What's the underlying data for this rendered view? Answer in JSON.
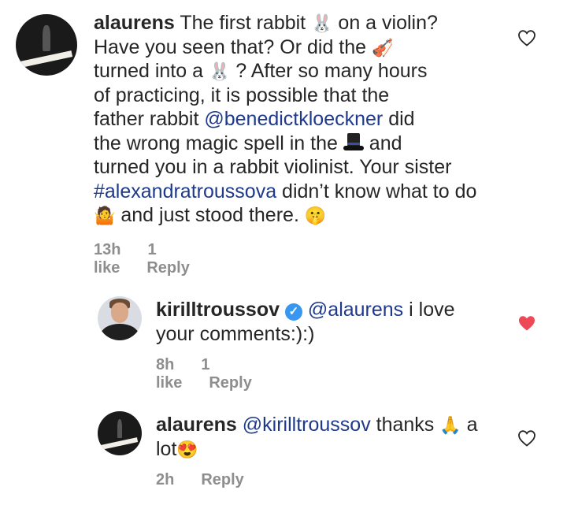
{
  "comments": [
    {
      "username": "alaurens",
      "lines": [
        [
          "The first rabbit ",
          "rabbit-emoji",
          " on a violin?"
        ],
        [
          "Have you seen that? Or did the ",
          "violin-emoji"
        ],
        [
          "turned into a ",
          "rabbit-emoji",
          " ? After so many hours"
        ],
        [
          "of practicing, it is possible that the"
        ],
        [
          "father rabbit ",
          "@benedictkloeckner",
          " did"
        ],
        [
          "the wrong magic spell in the ",
          "tophat-emoji",
          " and"
        ],
        [
          "turned you in a rabbit violinist. Your sister"
        ],
        [
          "#alexandratroussova",
          " didn’t know what to do"
        ],
        [
          "shrug-emoji",
          " and just stood there. ",
          "shush-emoji"
        ]
      ],
      "time": "13h",
      "likes": "1 like",
      "reply": "Reply",
      "liked": false
    },
    {
      "username": "kirilltroussov",
      "verified": true,
      "line1_mention": "@alaurens",
      "line1_text": " i love",
      "line2_text": "your comments:):)",
      "time": "8h",
      "likes": "1 like",
      "reply": "Reply",
      "liked": true
    },
    {
      "username": "alaurens",
      "line1_mention": "@kirilltroussov",
      "line1_text": " thanks ",
      "line1_tail": " a",
      "line2_text": "lot",
      "time": "2h",
      "reply": "Reply",
      "liked": false
    }
  ],
  "icons": {
    "rabbit-emoji": "🐰",
    "violin-emoji": "🎻",
    "shrug-emoji": "🤷",
    "shush-emoji": "🤫",
    "pray-emoji": "🙏",
    "heart-eyes-emoji": "😍"
  },
  "colors": {
    "mention": "#1f3a8c",
    "liked_heart": "#ed4956",
    "meta": "#8e8e8e",
    "verified": "#3897f0"
  }
}
